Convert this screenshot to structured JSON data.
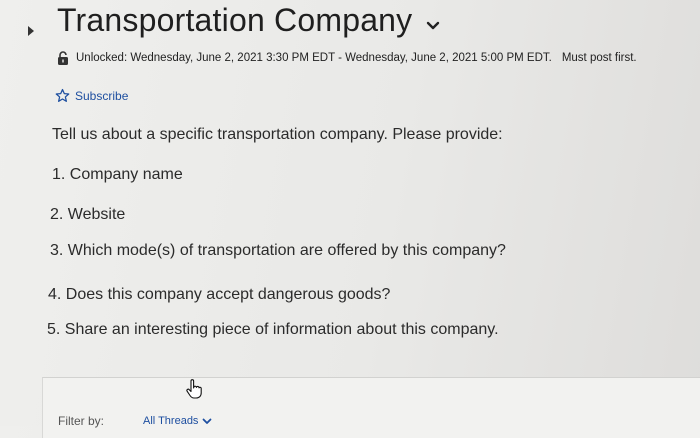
{
  "topic": {
    "title": "Transportation Company",
    "title_chevron_icon": "chevron-down-icon",
    "collapse_icon": "caret-right-icon"
  },
  "status": {
    "lock_icon": "unlocked-padlock-icon",
    "availability": "Unlocked: Wednesday, June 2, 2021 3:30 PM EDT - Wednesday, June 2, 2021 5:00 PM EDT.",
    "note": "Must post first."
  },
  "subscribe": {
    "icon": "star-outline-icon",
    "label": "Subscribe",
    "color": "#1e4fa0"
  },
  "description": {
    "prompt": "Tell us about a specific transportation company. Please provide:",
    "items": [
      "1. Company name",
      "2. Website",
      "3. Which mode(s) of transportation are offered by this company?",
      "4. Does this company accept dangerous goods?",
      "5. Share an interesting piece of information about this company."
    ]
  },
  "filter": {
    "label": "Filter by:",
    "selected": "All Threads",
    "chevron_icon": "chevron-down-icon"
  },
  "cursor": {
    "icon": "hand-pointer-icon"
  }
}
